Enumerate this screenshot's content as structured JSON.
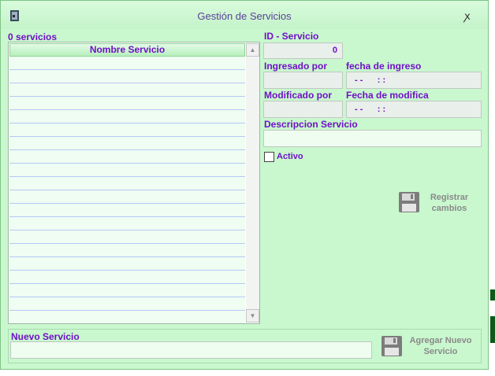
{
  "window": {
    "title": "Gestión de Servicios",
    "close_glyph": "ꭗ"
  },
  "list": {
    "count_label": "0 servicios",
    "column_header": "Nombre Servicio",
    "row_count": 21,
    "scroll_up": "▲",
    "scroll_down": "▼"
  },
  "form": {
    "id_label": "ID - Servicio",
    "id_value": "0",
    "ingresado_label": "Ingresado por",
    "fecha_ingreso_label": "fecha de ingreso",
    "fecha_ingreso_value": "- -      : :",
    "modificado_label": "Modificado por",
    "fecha_modifica_label": "Fecha de modifica",
    "fecha_modifica_value": "- -      : :",
    "descripcion_label": "Descripcion Servicio",
    "activo_label": "Activo"
  },
  "buttons": {
    "registrar_line1": "Registrar",
    "registrar_line2": "cambios",
    "agregar_line1": "Agregar Nuevo",
    "agregar_line2": "Servicio"
  },
  "nuevo": {
    "label": "Nuevo Servicio"
  },
  "icons": {
    "window": "app-door-icon",
    "save": "floppy-disk-icon"
  }
}
